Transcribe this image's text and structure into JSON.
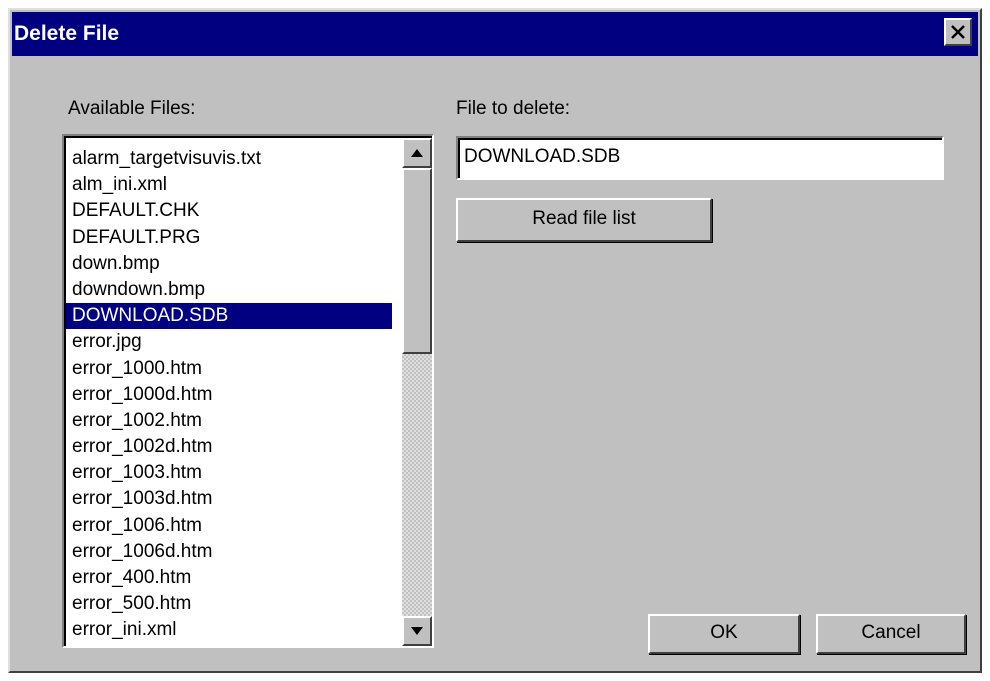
{
  "window": {
    "title": "Delete File"
  },
  "available_files": {
    "label": "Available Files:",
    "items": [
      "alarm_targetvisuvis.txt",
      "alm_ini.xml",
      "DEFAULT.CHK",
      "DEFAULT.PRG",
      "down.bmp",
      "downdown.bmp",
      "DOWNLOAD.SDB",
      "error.jpg",
      "error_1000.htm",
      "error_1000d.htm",
      "error_1002.htm",
      "error_1002d.htm",
      "error_1003.htm",
      "error_1003d.htm",
      "error_1006.htm",
      "error_1006d.htm",
      "error_400.htm",
      "error_500.htm",
      "error_ini.xml"
    ],
    "selected": "DOWNLOAD.SDB"
  },
  "file_to_delete": {
    "label": "File to delete:",
    "value": "DOWNLOAD.SDB"
  },
  "buttons": {
    "read_file_list": "Read file list",
    "ok": "OK",
    "cancel": "Cancel"
  },
  "icons": {
    "close": "close-icon",
    "scroll_up": "arrow-up-icon",
    "scroll_down": "arrow-down-icon"
  },
  "colors": {
    "titlebar": "#000080",
    "selection": "#000080",
    "face": "#c0c0c0"
  }
}
